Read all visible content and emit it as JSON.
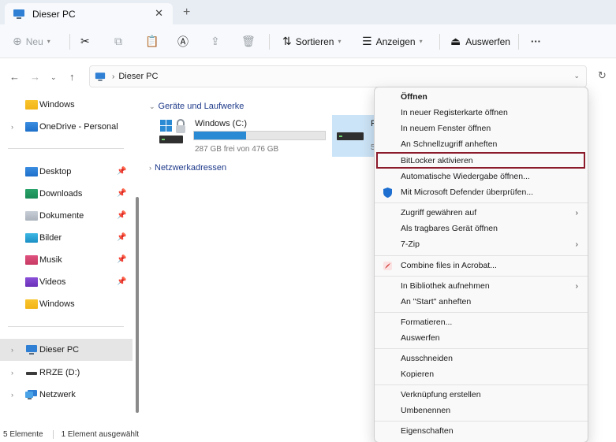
{
  "window": {
    "tab_title": "Dieser PC",
    "tab_close": "✕",
    "new_tab": "+"
  },
  "toolbar": {
    "new_label": "Neu",
    "sort_label": "Sortieren",
    "view_label": "Anzeigen",
    "eject_label": "Auswerfen",
    "more_label": "···"
  },
  "address": {
    "crumb": "Dieser PC"
  },
  "sidebar": {
    "items": [
      {
        "label": "Windows"
      },
      {
        "label": "OneDrive - Personal"
      },
      {
        "label": "Desktop"
      },
      {
        "label": "Downloads"
      },
      {
        "label": "Dokumente"
      },
      {
        "label": "Bilder"
      },
      {
        "label": "Musik"
      },
      {
        "label": "Videos"
      },
      {
        "label": "Windows"
      },
      {
        "label": "Dieser PC"
      },
      {
        "label": "RRZE (D:)"
      },
      {
        "label": "Netzwerk"
      }
    ]
  },
  "main": {
    "group_devices": "Geräte und Laufwerke",
    "group_network": "Netzwerkadressen",
    "drive_c": {
      "name": "Windows (C:)",
      "free_text": "287 GB frei von 476 GB",
      "used_fraction": 0.397
    },
    "drive_d": {
      "name_partial": "R",
      "sub_partial": "5"
    }
  },
  "status": {
    "count": "5 Elemente",
    "selected": "1 Element ausgewählt"
  },
  "context_menu": {
    "items": [
      {
        "label": "Öffnen"
      },
      {
        "label": "In neuer Registerkarte öffnen"
      },
      {
        "label": "In neuem Fenster öffnen"
      },
      {
        "label": "An Schnellzugriff anheften"
      },
      {
        "label": "BitLocker aktivieren"
      },
      {
        "label": "Automatische Wiedergabe öffnen..."
      },
      {
        "label": "Mit Microsoft Defender überprüfen..."
      },
      {
        "label": "Zugriff gewähren auf"
      },
      {
        "label": "Als tragbares Gerät öffnen"
      },
      {
        "label": "7-Zip"
      },
      {
        "label": "Combine files in Acrobat..."
      },
      {
        "label": "In Bibliothek aufnehmen"
      },
      {
        "label": "An \"Start\" anheften"
      },
      {
        "label": "Formatieren..."
      },
      {
        "label": "Auswerfen"
      },
      {
        "label": "Ausschneiden"
      },
      {
        "label": "Kopieren"
      },
      {
        "label": "Verknüpfung erstellen"
      },
      {
        "label": "Umbenennen"
      },
      {
        "label": "Eigenschaften"
      }
    ]
  },
  "colors": {
    "accent": "#2a8ad4",
    "highlight_border": "#8b1a2b",
    "selection": "#cce4f7"
  }
}
